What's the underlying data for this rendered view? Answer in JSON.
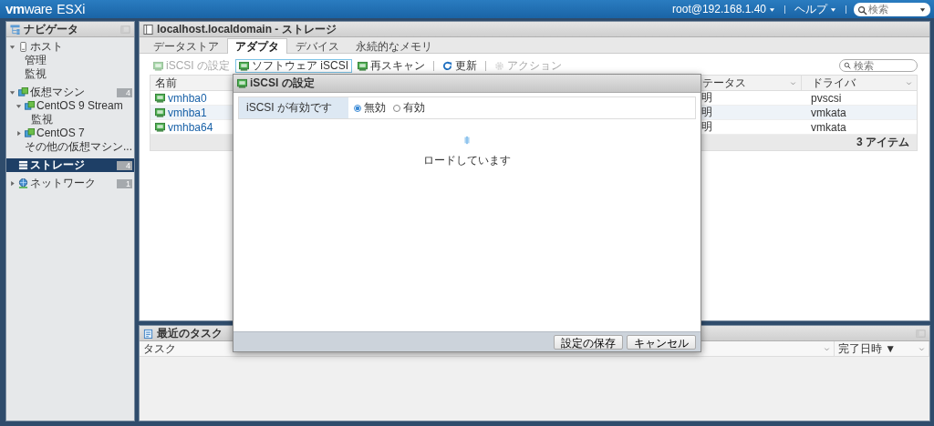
{
  "header": {
    "logo": "**vm**ware",
    "product": "ESXi",
    "user": "root@192.168.1.40",
    "help": "ヘルプ",
    "search": {
      "placeholder": "検索"
    }
  },
  "navigator": {
    "title": "ナビゲータ",
    "items": [
      {
        "label": "ホスト",
        "kind": "host",
        "expanded": true,
        "selected": false,
        "children": [
          {
            "label": "管理",
            "selected": false
          },
          {
            "label": "監視",
            "selected": false
          }
        ]
      },
      {
        "label": "仮想マシン",
        "kind": "vm",
        "expanded": true,
        "selected": false,
        "badge": "4",
        "children": [
          {
            "label": "CentOS 9 Stream",
            "kind": "vm",
            "expanded": true,
            "selected": false,
            "children": [
              {
                "label": "監視",
                "selected": false
              }
            ]
          },
          {
            "label": "CentOS 7",
            "kind": "vm",
            "expanded": false,
            "selected": false
          },
          {
            "label": "その他の仮想マシン...",
            "selected": false
          }
        ]
      },
      {
        "label": "ストレージ",
        "kind": "storage",
        "selected": true,
        "badge": "4"
      },
      {
        "label": "ネットワーク",
        "kind": "network",
        "expanded": false,
        "selected": false,
        "badge": "1"
      }
    ]
  },
  "main": {
    "title": "localhost.localdomain - ストレージ",
    "tabs": [
      {
        "label": "データストア",
        "selected": false
      },
      {
        "label": "アダプタ",
        "selected": true
      },
      {
        "label": "デバイス",
        "selected": false
      },
      {
        "label": "永続的なメモリ",
        "selected": false
      }
    ],
    "toolbar": [
      {
        "kind": "adapter",
        "label": "iSCSI の設定",
        "disabled": true,
        "focused": false
      },
      {
        "kind": "adapter",
        "label": "ソフトウェア iSCSI",
        "disabled": false,
        "focused": true
      },
      {
        "kind": "adapter",
        "label": "再スキャン",
        "disabled": false,
        "focused": false
      },
      {
        "kind": "separator"
      },
      {
        "kind": "refresh",
        "label": "更新",
        "disabled": false,
        "focused": false
      },
      {
        "kind": "separator"
      },
      {
        "kind": "action",
        "label": "アクション",
        "disabled": true,
        "focused": false
      }
    ],
    "search": {
      "placeholder": "検索"
    },
    "table": {
      "columns": [
        {
          "label": "名前"
        },
        {
          "label": "テータス"
        },
        {
          "label": "ドライバ"
        }
      ],
      "rows": [
        {
          "name": "vmhba0",
          "column_2": "明",
          "driver": "pvscsi"
        },
        {
          "name": "vmhba1",
          "column_2": "明",
          "driver": "vmkata"
        },
        {
          "name": "vmhba64",
          "column_2": "明",
          "driver": "vmkata"
        }
      ],
      "footer": "3 アイテム"
    }
  },
  "tasks": {
    "title": "最近のタスク",
    "columns": [
      {
        "label": "タスク"
      },
      {
        "label": "完了日時 ▼"
      }
    ]
  },
  "dialog": {
    "title": "iSCSI の設定",
    "field": {
      "label": "iSCSI が有効です",
      "options": [
        {
          "label": "無効",
          "selected": true
        },
        {
          "label": "有効",
          "selected": false
        }
      ]
    },
    "loading": "ロードしています",
    "buttons": [
      "設定の保存",
      "キャンセル"
    ]
  }
}
